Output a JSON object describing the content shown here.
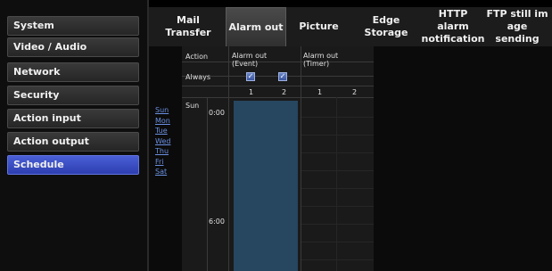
{
  "sidebar": {
    "items": [
      {
        "label": "System"
      },
      {
        "label": "Video / Audio"
      },
      {
        "label": "Network"
      },
      {
        "label": "Security"
      },
      {
        "label": "Action input"
      },
      {
        "label": "Action output"
      },
      {
        "label": "Schedule"
      }
    ],
    "active_index": 6
  },
  "tabs": [
    {
      "label": "Mail Transfer"
    },
    {
      "label": "Alarm out"
    },
    {
      "label": "Picture"
    },
    {
      "label": "Edge Storage"
    },
    {
      "label": "HTTP alarm\nnotification"
    },
    {
      "label": "FTP still im\nage sending"
    }
  ],
  "active_tab": "Alarm out",
  "days": [
    "Sun",
    "Mon",
    "Tue",
    "Wed",
    "Thu",
    "Fri",
    "Sat"
  ],
  "schedule": {
    "action_label": "Action",
    "col_event": "Alarm out\n(Event)",
    "col_timer": "Alarm out\n(Timer)",
    "always_label": "Always",
    "col_numbers": [
      "1",
      "2",
      "1",
      "2"
    ],
    "day_label": "Sun",
    "times": [
      "0:00",
      "6:00"
    ],
    "always_event_1_checked": true,
    "always_event_2_checked": true
  },
  "colors": {
    "accent": "#3b4fc8",
    "blue_block": "#27465f",
    "link": "#6a8fe0"
  }
}
